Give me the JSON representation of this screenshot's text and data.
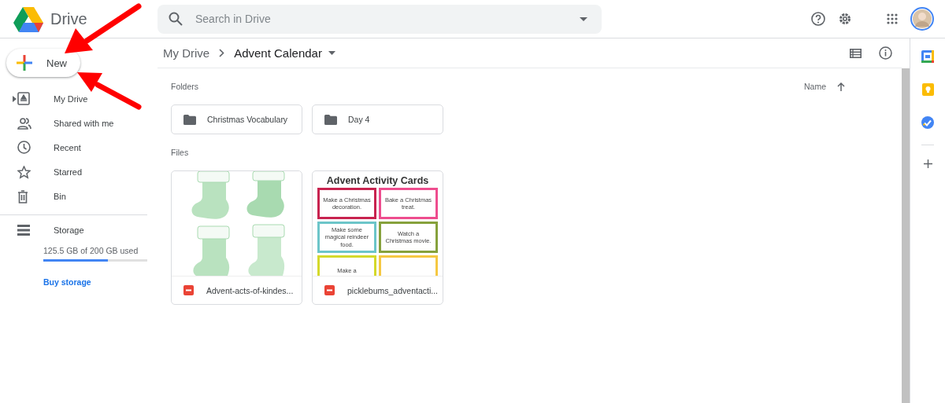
{
  "app": {
    "name": "Drive"
  },
  "search": {
    "placeholder": "Search in Drive"
  },
  "new_button": {
    "label": "New"
  },
  "sidebar": {
    "items": [
      {
        "label": "My Drive",
        "expandable": true,
        "selected": false
      },
      {
        "label": "Shared with me",
        "expandable": false,
        "selected": false
      },
      {
        "label": "Recent",
        "expandable": false,
        "selected": false
      },
      {
        "label": "Starred",
        "expandable": false,
        "selected": false
      },
      {
        "label": "Bin",
        "expandable": false,
        "selected": false
      }
    ]
  },
  "storage": {
    "label": "Storage",
    "usage": "125.5 GB of 200 GB used",
    "level": 0.62,
    "link": "Buy storage"
  },
  "breadcrumb": [
    "My Drive",
    "Advent Calendar"
  ],
  "folders_title": "Folders",
  "sort": {
    "label": "Name"
  },
  "folders": [
    {
      "name": "Christmas Vocabulary"
    },
    {
      "name": "Day 4"
    }
  ],
  "files_title": "Files",
  "files": [
    {
      "name": "Advent-acts-of-kindes..."
    },
    {
      "name": "picklebums_adventacti...",
      "thumbnail": {
        "kind": "document",
        "title": "Advent Activity Cards",
        "cards": [
          {
            "text": "Make a Christmas decoration.",
            "color": "#c8234f"
          },
          {
            "text": "Bake a Christmas treat.",
            "color": "#ee4d8e"
          },
          {
            "text": "Make some magical reindeer food.",
            "color": "#6cc5c9"
          },
          {
            "text": "Watch a Christmas movie.",
            "color": "#86a13c"
          },
          {
            "text": "Make a",
            "color": "#d4d92b"
          },
          {
            "color": "#f5c842"
          }
        ]
      }
    }
  ]
}
